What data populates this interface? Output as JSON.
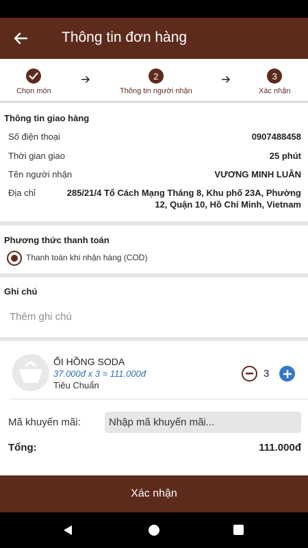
{
  "header": {
    "title": "Thông tin đơn hàng"
  },
  "steps": [
    {
      "number": "",
      "label": "Chọn món"
    },
    {
      "number": "2",
      "label": "Thông tin người nhận"
    },
    {
      "number": "3",
      "label": "Xác nhận"
    }
  ],
  "delivery": {
    "title": "Thông tin giao hàng",
    "rows": [
      {
        "label": "Số điện thoại",
        "value": "0907488458"
      },
      {
        "label": "Thời gian giao",
        "value": "25 phút"
      },
      {
        "label": "Tên người nhận",
        "value": "VƯƠNG MINH LUÂN"
      },
      {
        "label": "Địa chỉ",
        "value_line1": "285/21/4 Tổ Cách Mạng Tháng 8, Khu phố 23A, Phường",
        "value_line2": "12, Quận 10, Hồ Chí Minh, Vietnam"
      }
    ]
  },
  "payment": {
    "title": "Phương thức thanh toán",
    "option": "Thanh toán khi nhận hàng (COD)"
  },
  "note": {
    "title": "Ghi chú",
    "placeholder": "Thêm ghi chú"
  },
  "item": {
    "name": "ỔI HỒNG SODA",
    "price_line": "37.000đ x 3 = 111.000đ",
    "variant": "Tiêu Chuẩn",
    "quantity": "3"
  },
  "promo": {
    "label": "Mã khuyến mãi:",
    "placeholder": "Nhập mã khuyến mãi..."
  },
  "total": {
    "label": "Tổng:",
    "value": "111.000đ"
  },
  "confirm_label": "Xác nhận",
  "colors": {
    "brand": "#5d2b1c",
    "accent_blue": "#3478c6",
    "price_blue": "#2d6fb7"
  },
  "icons": [
    "back-arrow-icon",
    "check-icon",
    "arrow-right-icon",
    "drink-cup-icon",
    "minus-icon",
    "plus-icon",
    "nav-back-icon",
    "nav-home-icon",
    "nav-recent-icon"
  ]
}
